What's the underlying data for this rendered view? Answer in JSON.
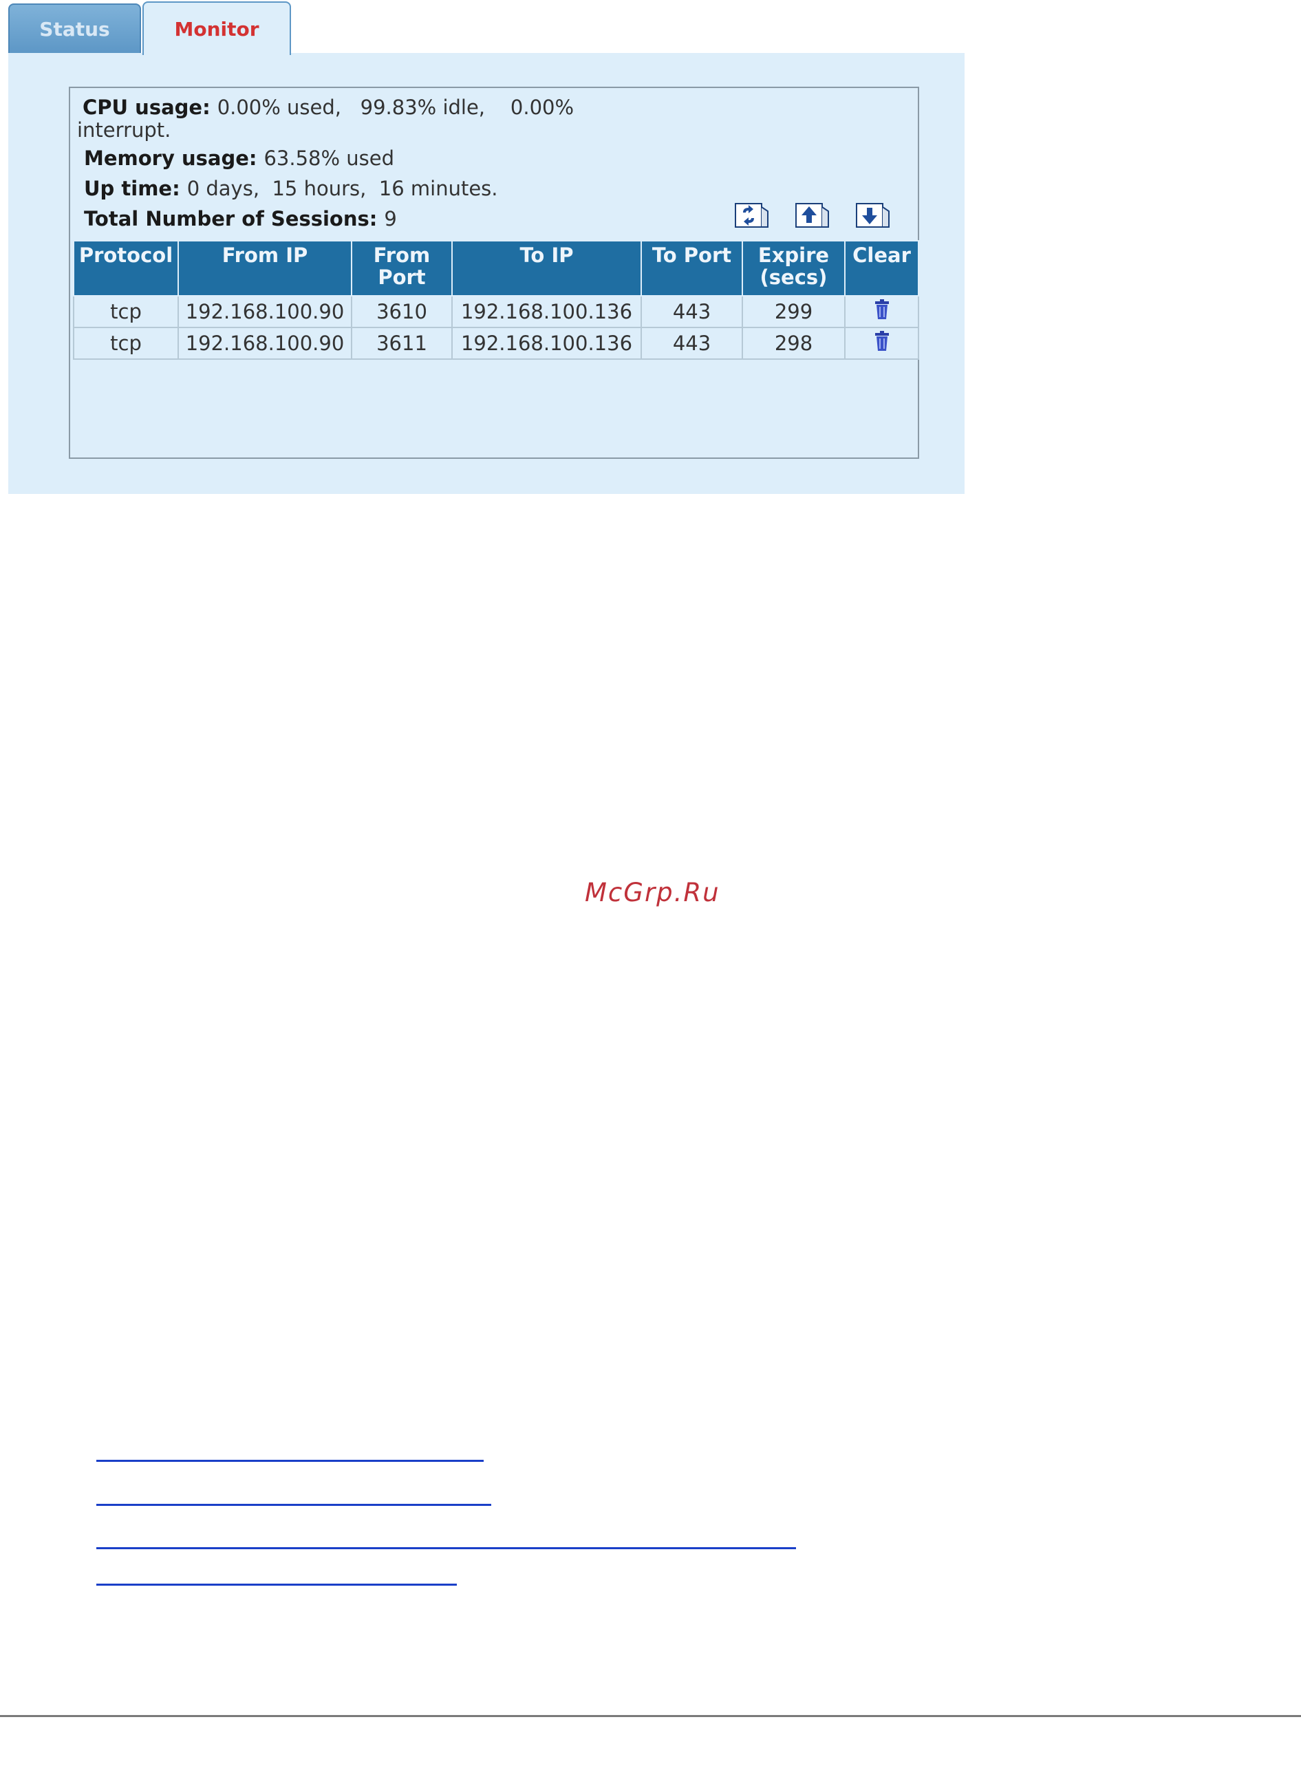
{
  "tabs": [
    {
      "label": "Status"
    },
    {
      "label": "Monitor"
    }
  ],
  "stats": {
    "cpu_label": "CPU usage:",
    "cpu_value": "0.00% used,   99.83% idle,    0.00%",
    "cpu_value_cont": "interrupt.",
    "memory_label": "Memory usage:",
    "memory_value": "63.58% used",
    "uptime_label": "Up time:",
    "uptime_value": "0 days,  15 hours,  16 minutes.",
    "sessions_label": "Total Number of Sessions:",
    "sessions_value": "9"
  },
  "toolbar_icons": [
    "refresh-icon",
    "page-up-icon",
    "page-down-icon"
  ],
  "table": {
    "headers": [
      "Protocol",
      "From IP",
      "From Port",
      "To IP",
      "To Port",
      "Expire (secs)",
      "Clear"
    ],
    "rows": [
      {
        "protocol": "tcp",
        "from_ip": "192.168.100.90",
        "from_port": "3610",
        "to_ip": "192.168.100.136",
        "to_port": "443",
        "expire": "299",
        "clear_icon": "trash-icon"
      },
      {
        "protocol": "tcp",
        "from_ip": "192.168.100.90",
        "from_port": "3611",
        "to_ip": "192.168.100.136",
        "to_port": "443",
        "expire": "298",
        "clear_icon": "trash-icon"
      }
    ]
  },
  "watermark": "McGrp.Ru",
  "colors": {
    "panel_bg": "#ddeefa",
    "header_bg": "#1f6ea2",
    "active_tab_text": "#d33232",
    "link": "#1a3fc8"
  }
}
